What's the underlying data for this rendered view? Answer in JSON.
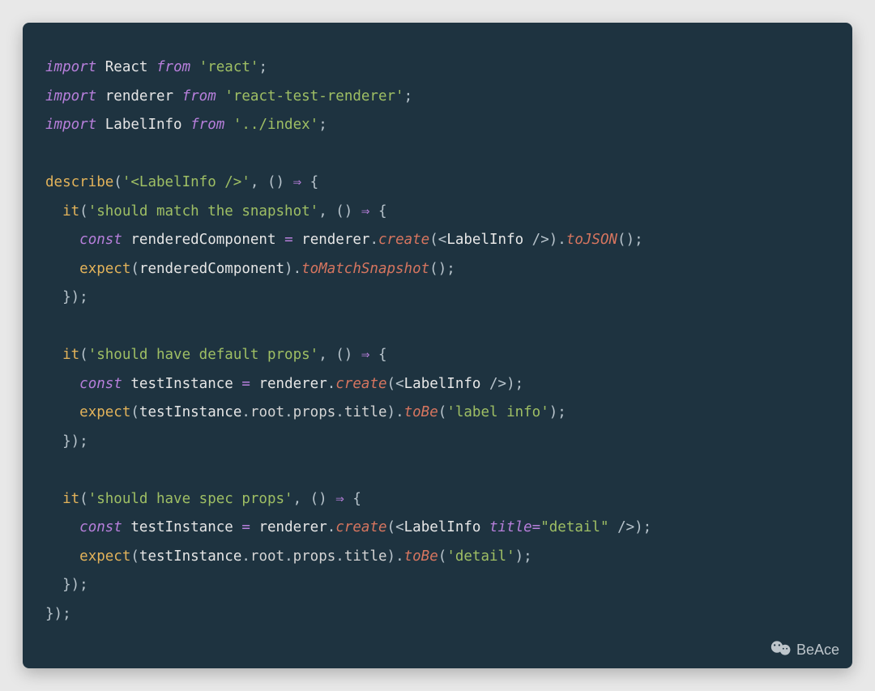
{
  "watermark": "BeAce",
  "code": {
    "lines": [
      [
        {
          "c": "kw",
          "t": "import"
        },
        {
          "c": "punct",
          "t": " "
        },
        {
          "c": "ident",
          "t": "React"
        },
        {
          "c": "punct",
          "t": " "
        },
        {
          "c": "kw",
          "t": "from"
        },
        {
          "c": "punct",
          "t": " "
        },
        {
          "c": "str",
          "t": "'react'"
        },
        {
          "c": "punct",
          "t": ";"
        }
      ],
      [
        {
          "c": "kw",
          "t": "import"
        },
        {
          "c": "punct",
          "t": " "
        },
        {
          "c": "ident",
          "t": "renderer"
        },
        {
          "c": "punct",
          "t": " "
        },
        {
          "c": "kw",
          "t": "from"
        },
        {
          "c": "punct",
          "t": " "
        },
        {
          "c": "str",
          "t": "'react-test-renderer'"
        },
        {
          "c": "punct",
          "t": ";"
        }
      ],
      [
        {
          "c": "kw",
          "t": "import"
        },
        {
          "c": "punct",
          "t": " "
        },
        {
          "c": "ident",
          "t": "LabelInfo"
        },
        {
          "c": "punct",
          "t": " "
        },
        {
          "c": "kw",
          "t": "from"
        },
        {
          "c": "punct",
          "t": " "
        },
        {
          "c": "str",
          "t": "'../index'"
        },
        {
          "c": "punct",
          "t": ";"
        }
      ],
      [],
      [
        {
          "c": "fn",
          "t": "describe"
        },
        {
          "c": "punct",
          "t": "("
        },
        {
          "c": "str",
          "t": "'<LabelInfo />'"
        },
        {
          "c": "punct",
          "t": ", () "
        },
        {
          "c": "arrow",
          "t": "⇒"
        },
        {
          "c": "punct",
          "t": " {"
        }
      ],
      [
        {
          "c": "punct",
          "t": "  "
        },
        {
          "c": "fn",
          "t": "it"
        },
        {
          "c": "punct",
          "t": "("
        },
        {
          "c": "str",
          "t": "'should match the snapshot'"
        },
        {
          "c": "punct",
          "t": ", () "
        },
        {
          "c": "arrow",
          "t": "⇒"
        },
        {
          "c": "punct",
          "t": " {"
        }
      ],
      [
        {
          "c": "punct",
          "t": "    "
        },
        {
          "c": "kw",
          "t": "const"
        },
        {
          "c": "punct",
          "t": " "
        },
        {
          "c": "ident",
          "t": "renderedComponent"
        },
        {
          "c": "punct",
          "t": " "
        },
        {
          "c": "op",
          "t": "="
        },
        {
          "c": "punct",
          "t": " "
        },
        {
          "c": "ident",
          "t": "renderer"
        },
        {
          "c": "punct",
          "t": "."
        },
        {
          "c": "method",
          "t": "create"
        },
        {
          "c": "punct",
          "t": "("
        },
        {
          "c": "jsxangle",
          "t": "<"
        },
        {
          "c": "jsx",
          "t": "LabelInfo "
        },
        {
          "c": "jsxangle",
          "t": "/>"
        },
        {
          "c": "punct",
          "t": ")."
        },
        {
          "c": "method",
          "t": "toJSON"
        },
        {
          "c": "punct",
          "t": "();"
        }
      ],
      [
        {
          "c": "punct",
          "t": "    "
        },
        {
          "c": "fn",
          "t": "expect"
        },
        {
          "c": "punct",
          "t": "("
        },
        {
          "c": "ident",
          "t": "renderedComponent"
        },
        {
          "c": "punct",
          "t": ")."
        },
        {
          "c": "method",
          "t": "toMatchSnapshot"
        },
        {
          "c": "punct",
          "t": "();"
        }
      ],
      [
        {
          "c": "punct",
          "t": "  });"
        }
      ],
      [],
      [
        {
          "c": "punct",
          "t": "  "
        },
        {
          "c": "fn",
          "t": "it"
        },
        {
          "c": "punct",
          "t": "("
        },
        {
          "c": "str",
          "t": "'should have default props'"
        },
        {
          "c": "punct",
          "t": ", () "
        },
        {
          "c": "arrow",
          "t": "⇒"
        },
        {
          "c": "punct",
          "t": " {"
        }
      ],
      [
        {
          "c": "punct",
          "t": "    "
        },
        {
          "c": "kw",
          "t": "const"
        },
        {
          "c": "punct",
          "t": " "
        },
        {
          "c": "ident",
          "t": "testInstance"
        },
        {
          "c": "punct",
          "t": " "
        },
        {
          "c": "op",
          "t": "="
        },
        {
          "c": "punct",
          "t": " "
        },
        {
          "c": "ident",
          "t": "renderer"
        },
        {
          "c": "punct",
          "t": "."
        },
        {
          "c": "method",
          "t": "create"
        },
        {
          "c": "punct",
          "t": "("
        },
        {
          "c": "jsxangle",
          "t": "<"
        },
        {
          "c": "jsx",
          "t": "LabelInfo "
        },
        {
          "c": "jsxangle",
          "t": "/>"
        },
        {
          "c": "punct",
          "t": ");"
        }
      ],
      [
        {
          "c": "punct",
          "t": "    "
        },
        {
          "c": "fn",
          "t": "expect"
        },
        {
          "c": "punct",
          "t": "("
        },
        {
          "c": "ident",
          "t": "testInstance"
        },
        {
          "c": "punct",
          "t": "."
        },
        {
          "c": "prop",
          "t": "root"
        },
        {
          "c": "punct",
          "t": "."
        },
        {
          "c": "prop",
          "t": "props"
        },
        {
          "c": "punct",
          "t": "."
        },
        {
          "c": "prop",
          "t": "title"
        },
        {
          "c": "punct",
          "t": ")."
        },
        {
          "c": "method",
          "t": "toBe"
        },
        {
          "c": "punct",
          "t": "("
        },
        {
          "c": "str",
          "t": "'label info'"
        },
        {
          "c": "punct",
          "t": ");"
        }
      ],
      [
        {
          "c": "punct",
          "t": "  });"
        }
      ],
      [],
      [
        {
          "c": "punct",
          "t": "  "
        },
        {
          "c": "fn",
          "t": "it"
        },
        {
          "c": "punct",
          "t": "("
        },
        {
          "c": "str",
          "t": "'should have spec props'"
        },
        {
          "c": "punct",
          "t": ", () "
        },
        {
          "c": "arrow",
          "t": "⇒"
        },
        {
          "c": "punct",
          "t": " {"
        }
      ],
      [
        {
          "c": "punct",
          "t": "    "
        },
        {
          "c": "kw",
          "t": "const"
        },
        {
          "c": "punct",
          "t": " "
        },
        {
          "c": "ident",
          "t": "testInstance"
        },
        {
          "c": "punct",
          "t": " "
        },
        {
          "c": "op",
          "t": "="
        },
        {
          "c": "punct",
          "t": " "
        },
        {
          "c": "ident",
          "t": "renderer"
        },
        {
          "c": "punct",
          "t": "."
        },
        {
          "c": "method",
          "t": "create"
        },
        {
          "c": "punct",
          "t": "("
        },
        {
          "c": "jsxangle",
          "t": "<"
        },
        {
          "c": "jsx",
          "t": "LabelInfo "
        },
        {
          "c": "attr",
          "t": "title"
        },
        {
          "c": "op",
          "t": "="
        },
        {
          "c": "str",
          "t": "\"detail\""
        },
        {
          "c": "punct",
          "t": " "
        },
        {
          "c": "jsxangle",
          "t": "/>"
        },
        {
          "c": "punct",
          "t": ");"
        }
      ],
      [
        {
          "c": "punct",
          "t": "    "
        },
        {
          "c": "fn",
          "t": "expect"
        },
        {
          "c": "punct",
          "t": "("
        },
        {
          "c": "ident",
          "t": "testInstance"
        },
        {
          "c": "punct",
          "t": "."
        },
        {
          "c": "prop",
          "t": "root"
        },
        {
          "c": "punct",
          "t": "."
        },
        {
          "c": "prop",
          "t": "props"
        },
        {
          "c": "punct",
          "t": "."
        },
        {
          "c": "prop",
          "t": "title"
        },
        {
          "c": "punct",
          "t": ")."
        },
        {
          "c": "method",
          "t": "toBe"
        },
        {
          "c": "punct",
          "t": "("
        },
        {
          "c": "str",
          "t": "'detail'"
        },
        {
          "c": "punct",
          "t": ");"
        }
      ],
      [
        {
          "c": "punct",
          "t": "  });"
        }
      ],
      [
        {
          "c": "punct",
          "t": "});"
        }
      ]
    ]
  }
}
